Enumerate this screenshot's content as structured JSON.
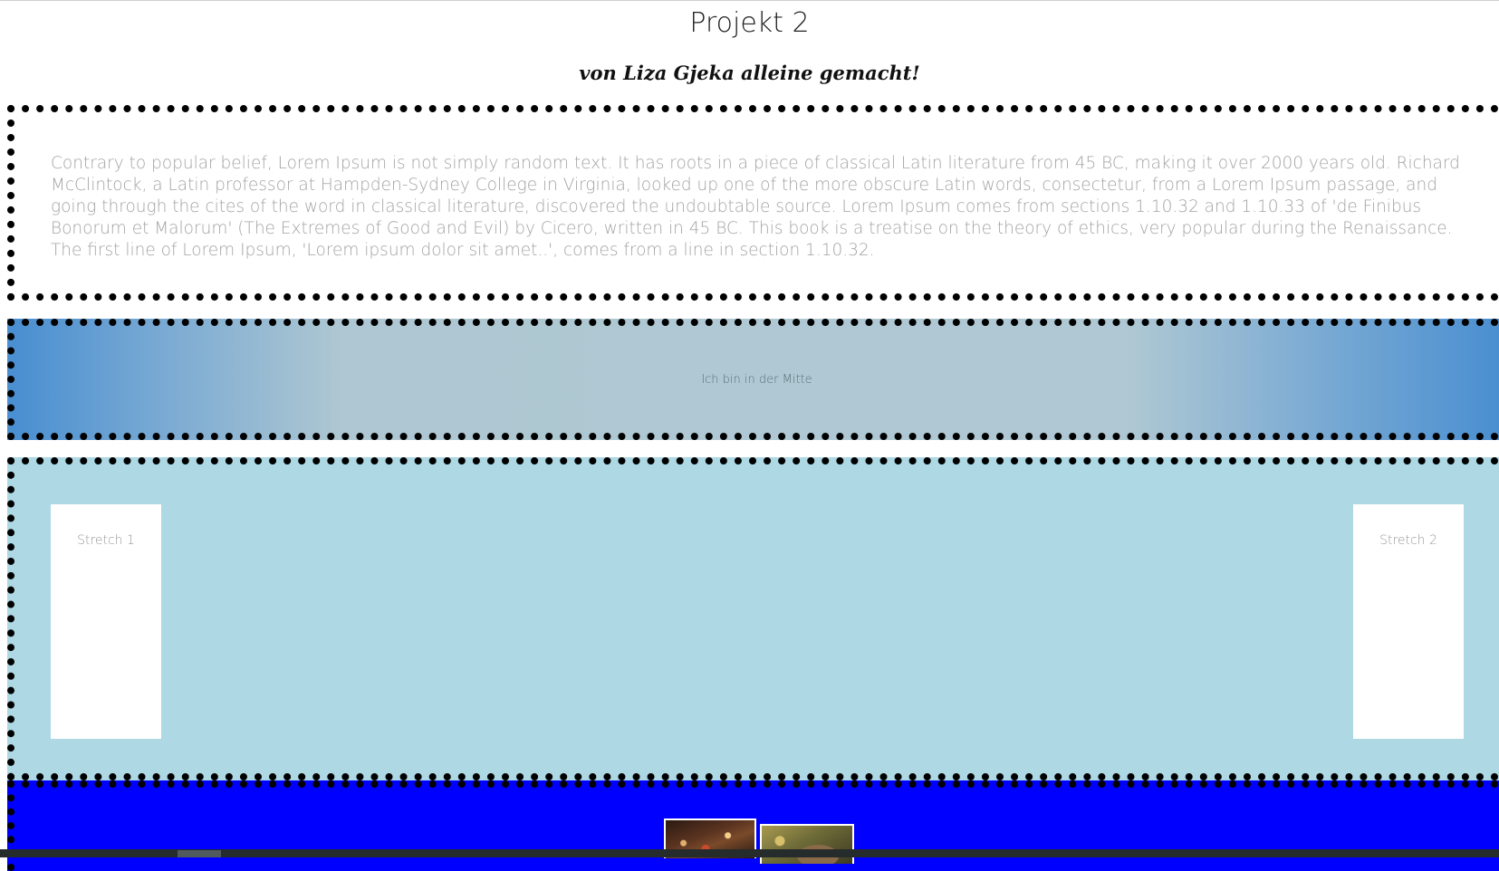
{
  "header": {
    "title": "Projekt 2",
    "subtitle": "von Liza Gjeka alleine gemacht!"
  },
  "text_section": {
    "paragraph": "Contrary to popular belief, Lorem Ipsum is not simply random text. It has roots in a piece of classical Latin literature from 45 BC, making it over 2000 years old. Richard McClintock, a Latin professor at Hampden-Sydney College in Virginia, looked up one of the more obscure Latin words, consectetur, from a Lorem Ipsum passage, and going through the cites of the word in classical literature, discovered the undoubtable source. Lorem Ipsum comes from sections 1.10.32 and 1.10.33 of 'de Finibus Bonorum et Malorum' (The Extremes of Good and Evil) by Cicero, written in 45 BC. This book is a treatise on the theory of ethics, very popular during the Renaissance. The first line of Lorem Ipsum, 'Lorem ipsum dolor sit amet..', comes from a line in section 1.10.32."
  },
  "gradient_section": {
    "label": "Ich bin in der Mitte"
  },
  "stretch_section": {
    "items": [
      {
        "label": "Stretch 1"
      },
      {
        "label": "Stretch 2"
      }
    ]
  },
  "gallery_section": {
    "images": [
      {
        "icon": "christmas-tree-photo"
      },
      {
        "icon": "cat-photo"
      }
    ]
  },
  "colors": {
    "page_background": "#ffffff",
    "stretch_background": "#add8e4",
    "gallery_background": "#0000ff",
    "gradient_edge": "#4a8fd1",
    "gradient_center": "#afc8d3",
    "border": "#000000"
  }
}
